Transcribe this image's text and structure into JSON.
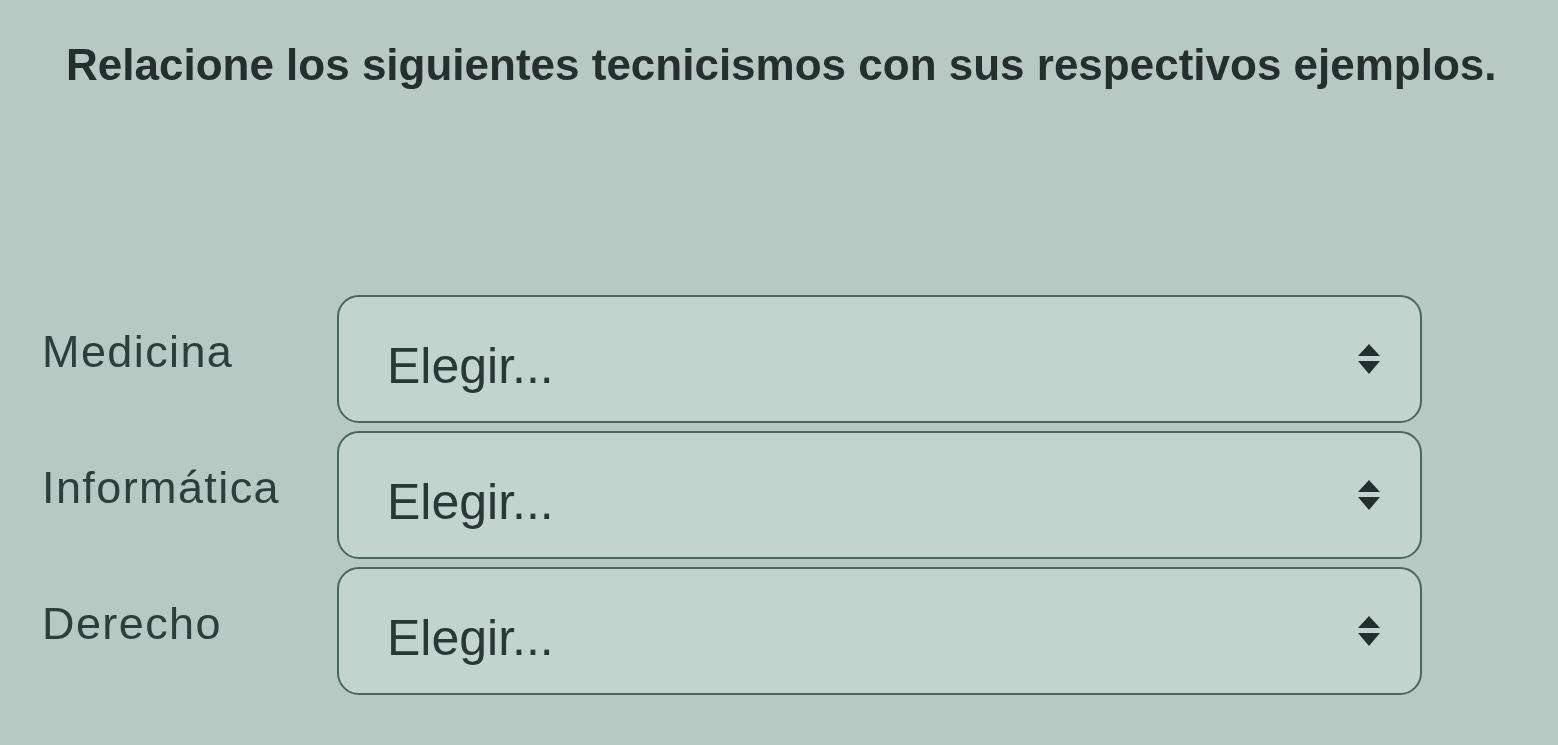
{
  "question": {
    "text": "Relacione los siguientes tecnicismos con sus respectivos ejemplos."
  },
  "rows": [
    {
      "term": "Medicina",
      "select": {
        "value": "Elegir..."
      }
    },
    {
      "term": "Informática",
      "select": {
        "value": "Elegir..."
      }
    },
    {
      "term": "Derecho",
      "select": {
        "value": "Elegir..."
      }
    }
  ]
}
